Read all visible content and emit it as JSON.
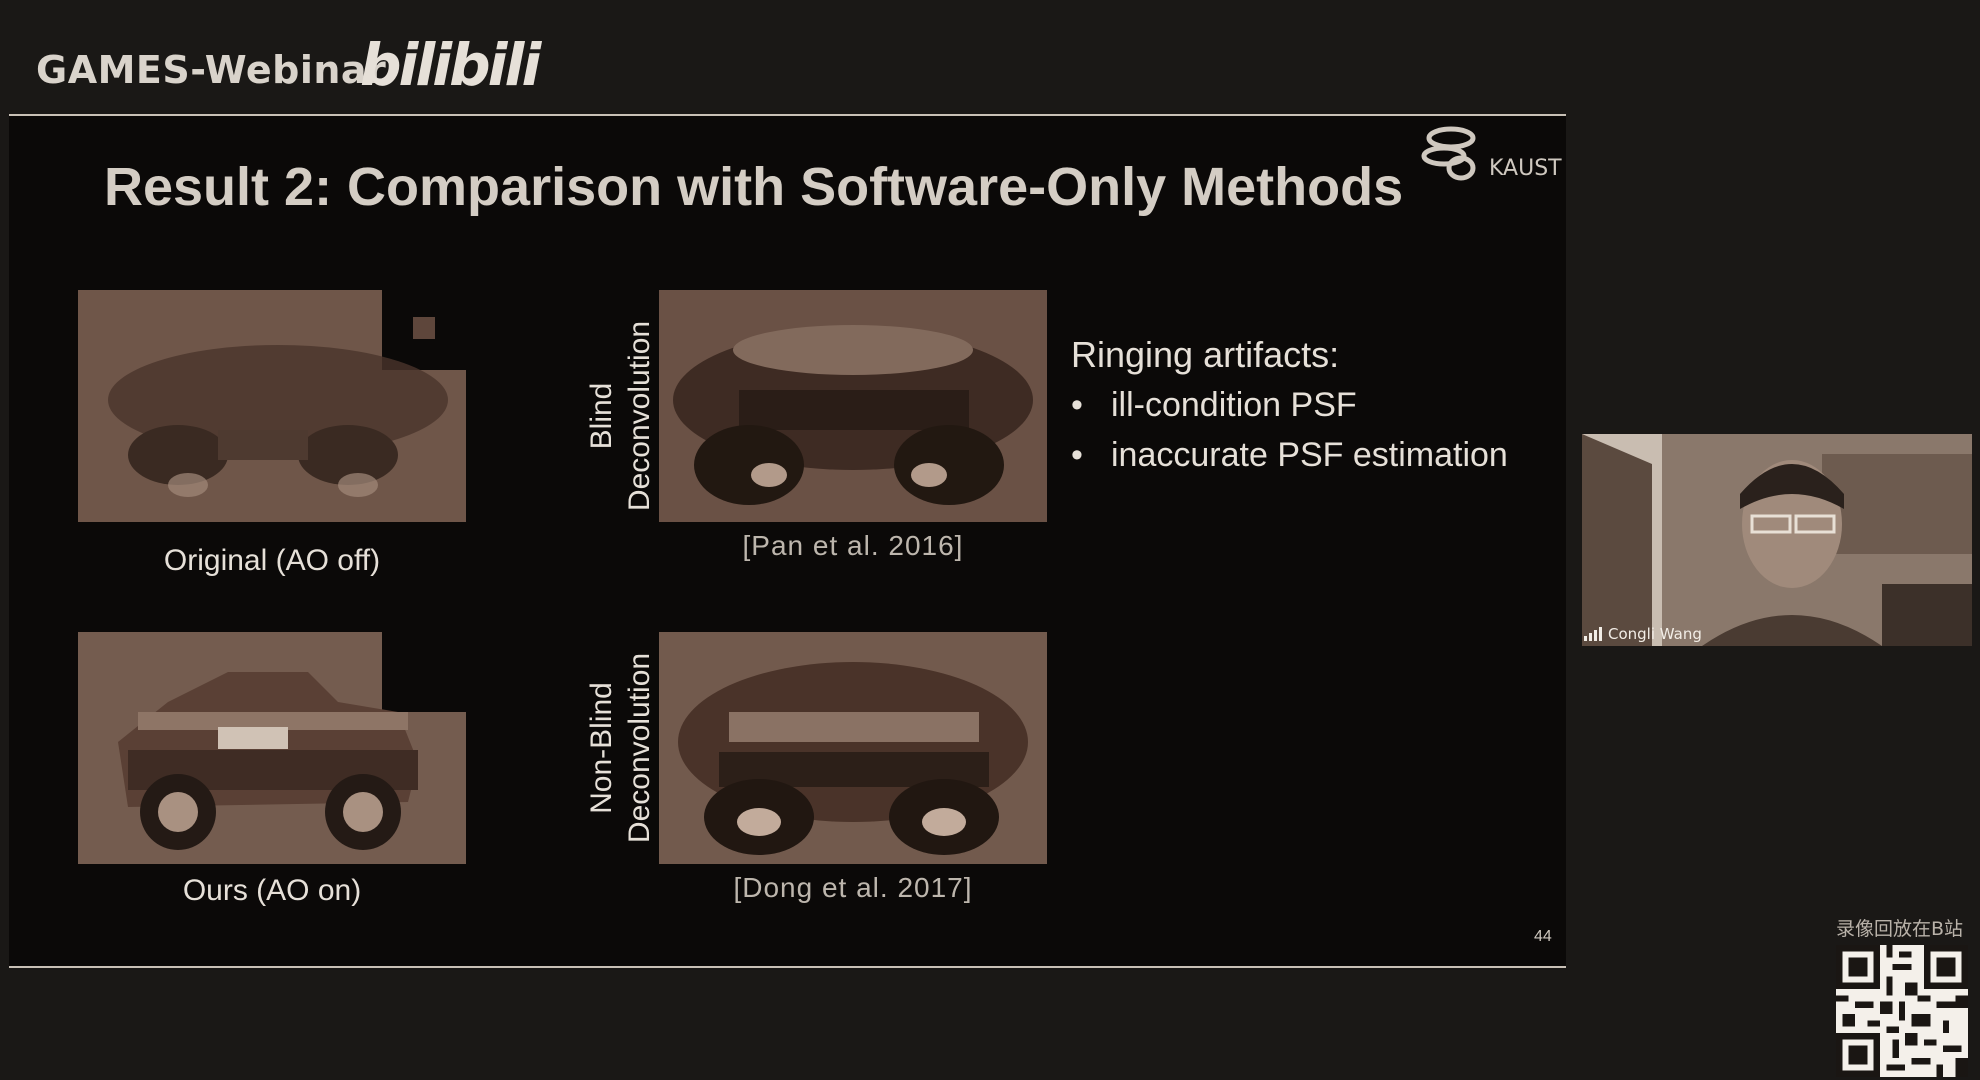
{
  "header": {
    "brand": "GAMES-Webinar",
    "logo_text": "bilibili"
  },
  "slide": {
    "title": "Result 2: Comparison with Software-Only Methods",
    "institution": "KAUST",
    "panels": {
      "original_caption": "Original (AO off)",
      "ours_caption": "Ours (AO on)",
      "blind_label_line1": "Blind",
      "blind_label_line2": "Deconvolution",
      "nonblind_label_line1": "Non-Blind",
      "nonblind_label_line2": "Deconvolution",
      "blind_cite": "[Pan et al. 2016]",
      "nonblind_cite": "[Dong et al. 2017]"
    },
    "notes": {
      "title": "Ringing artifacts:",
      "items": [
        "ill-condition PSF",
        "inaccurate PSF estimation"
      ]
    },
    "page_number": "44"
  },
  "video": {
    "speaker_name": "Congli Wang"
  },
  "footer": {
    "replay_text": "录像回放在B站"
  },
  "colors": {
    "background": "#1a1816",
    "slide_background": "#0b0908",
    "photo_tone": "#6b5347"
  },
  "icons": [
    "signal-icon",
    "kaust-logo-icon",
    "qr-code-icon"
  ]
}
